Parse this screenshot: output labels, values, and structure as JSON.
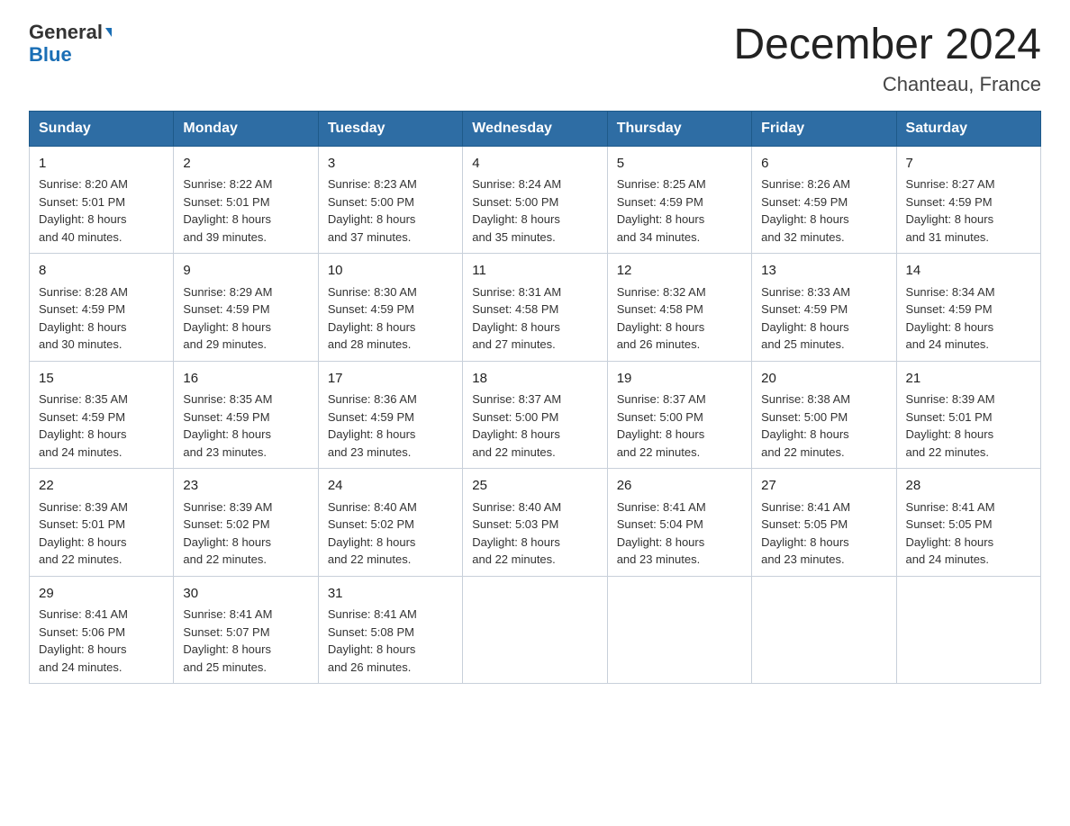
{
  "logo": {
    "general": "General",
    "blue": "Blue"
  },
  "title": "December 2024",
  "subtitle": "Chanteau, France",
  "days_header": [
    "Sunday",
    "Monday",
    "Tuesday",
    "Wednesday",
    "Thursday",
    "Friday",
    "Saturday"
  ],
  "weeks": [
    [
      {
        "num": "1",
        "sunrise": "8:20 AM",
        "sunset": "5:01 PM",
        "daylight": "8 hours and 40 minutes."
      },
      {
        "num": "2",
        "sunrise": "8:22 AM",
        "sunset": "5:01 PM",
        "daylight": "8 hours and 39 minutes."
      },
      {
        "num": "3",
        "sunrise": "8:23 AM",
        "sunset": "5:00 PM",
        "daylight": "8 hours and 37 minutes."
      },
      {
        "num": "4",
        "sunrise": "8:24 AM",
        "sunset": "5:00 PM",
        "daylight": "8 hours and 35 minutes."
      },
      {
        "num": "5",
        "sunrise": "8:25 AM",
        "sunset": "4:59 PM",
        "daylight": "8 hours and 34 minutes."
      },
      {
        "num": "6",
        "sunrise": "8:26 AM",
        "sunset": "4:59 PM",
        "daylight": "8 hours and 32 minutes."
      },
      {
        "num": "7",
        "sunrise": "8:27 AM",
        "sunset": "4:59 PM",
        "daylight": "8 hours and 31 minutes."
      }
    ],
    [
      {
        "num": "8",
        "sunrise": "8:28 AM",
        "sunset": "4:59 PM",
        "daylight": "8 hours and 30 minutes."
      },
      {
        "num": "9",
        "sunrise": "8:29 AM",
        "sunset": "4:59 PM",
        "daylight": "8 hours and 29 minutes."
      },
      {
        "num": "10",
        "sunrise": "8:30 AM",
        "sunset": "4:59 PM",
        "daylight": "8 hours and 28 minutes."
      },
      {
        "num": "11",
        "sunrise": "8:31 AM",
        "sunset": "4:58 PM",
        "daylight": "8 hours and 27 minutes."
      },
      {
        "num": "12",
        "sunrise": "8:32 AM",
        "sunset": "4:58 PM",
        "daylight": "8 hours and 26 minutes."
      },
      {
        "num": "13",
        "sunrise": "8:33 AM",
        "sunset": "4:59 PM",
        "daylight": "8 hours and 25 minutes."
      },
      {
        "num": "14",
        "sunrise": "8:34 AM",
        "sunset": "4:59 PM",
        "daylight": "8 hours and 24 minutes."
      }
    ],
    [
      {
        "num": "15",
        "sunrise": "8:35 AM",
        "sunset": "4:59 PM",
        "daylight": "8 hours and 24 minutes."
      },
      {
        "num": "16",
        "sunrise": "8:35 AM",
        "sunset": "4:59 PM",
        "daylight": "8 hours and 23 minutes."
      },
      {
        "num": "17",
        "sunrise": "8:36 AM",
        "sunset": "4:59 PM",
        "daylight": "8 hours and 23 minutes."
      },
      {
        "num": "18",
        "sunrise": "8:37 AM",
        "sunset": "5:00 PM",
        "daylight": "8 hours and 22 minutes."
      },
      {
        "num": "19",
        "sunrise": "8:37 AM",
        "sunset": "5:00 PM",
        "daylight": "8 hours and 22 minutes."
      },
      {
        "num": "20",
        "sunrise": "8:38 AM",
        "sunset": "5:00 PM",
        "daylight": "8 hours and 22 minutes."
      },
      {
        "num": "21",
        "sunrise": "8:39 AM",
        "sunset": "5:01 PM",
        "daylight": "8 hours and 22 minutes."
      }
    ],
    [
      {
        "num": "22",
        "sunrise": "8:39 AM",
        "sunset": "5:01 PM",
        "daylight": "8 hours and 22 minutes."
      },
      {
        "num": "23",
        "sunrise": "8:39 AM",
        "sunset": "5:02 PM",
        "daylight": "8 hours and 22 minutes."
      },
      {
        "num": "24",
        "sunrise": "8:40 AM",
        "sunset": "5:02 PM",
        "daylight": "8 hours and 22 minutes."
      },
      {
        "num": "25",
        "sunrise": "8:40 AM",
        "sunset": "5:03 PM",
        "daylight": "8 hours and 22 minutes."
      },
      {
        "num": "26",
        "sunrise": "8:41 AM",
        "sunset": "5:04 PM",
        "daylight": "8 hours and 23 minutes."
      },
      {
        "num": "27",
        "sunrise": "8:41 AM",
        "sunset": "5:05 PM",
        "daylight": "8 hours and 23 minutes."
      },
      {
        "num": "28",
        "sunrise": "8:41 AM",
        "sunset": "5:05 PM",
        "daylight": "8 hours and 24 minutes."
      }
    ],
    [
      {
        "num": "29",
        "sunrise": "8:41 AM",
        "sunset": "5:06 PM",
        "daylight": "8 hours and 24 minutes."
      },
      {
        "num": "30",
        "sunrise": "8:41 AM",
        "sunset": "5:07 PM",
        "daylight": "8 hours and 25 minutes."
      },
      {
        "num": "31",
        "sunrise": "8:41 AM",
        "sunset": "5:08 PM",
        "daylight": "8 hours and 26 minutes."
      },
      null,
      null,
      null,
      null
    ]
  ],
  "labels": {
    "sunrise": "Sunrise:",
    "sunset": "Sunset:",
    "daylight": "Daylight:"
  }
}
